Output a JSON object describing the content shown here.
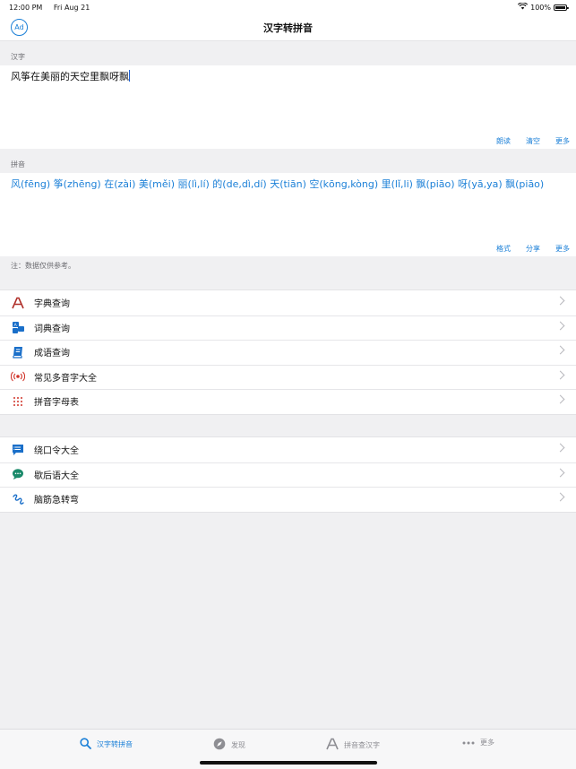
{
  "status_bar": {
    "time": "12:00 PM",
    "date": "Fri Aug 21",
    "battery": "100%"
  },
  "navbar": {
    "title": "汉字转拼音",
    "ad_label": "Ad"
  },
  "hanzi_section": {
    "label": "汉字",
    "text": "风筝在美丽的天空里飘呀飘",
    "actions": [
      "朗读",
      "清空",
      "更多"
    ]
  },
  "pinyin_section": {
    "label": "拼音",
    "text": "风(fēng) 筝(zhēng) 在(zài) 美(měi) 丽(lì,lí) 的(de,dì,dí) 天(tiān) 空(kōng,kòng) 里(lǐ,li) 飘(piāo) 呀(yā,ya) 飘(piāo)",
    "actions": [
      "格式",
      "分享",
      "更多"
    ]
  },
  "note": "注：数据仅供参考。",
  "menu_group_1": [
    {
      "label": "字典查询",
      "icon": "letter-a-icon"
    },
    {
      "label": "词典查询",
      "icon": "dictionary-blocks-icon"
    },
    {
      "label": "成语查询",
      "icon": "book-icon"
    },
    {
      "label": "常见多音字大全",
      "icon": "broadcast-icon"
    },
    {
      "label": "拼音字母表",
      "icon": "dots-grid-icon"
    }
  ],
  "menu_group_2": [
    {
      "label": "绕口令大全",
      "icon": "list-bubble-icon"
    },
    {
      "label": "歇后语大全",
      "icon": "chat-bubble-icon"
    },
    {
      "label": "脑筋急转弯",
      "icon": "squiggle-icon"
    }
  ],
  "tabs": [
    {
      "label": "汉字转拼音",
      "icon": "search-icon",
      "active": true
    },
    {
      "label": "发现",
      "icon": "compass-icon",
      "active": false
    },
    {
      "label": "拼音查汉字",
      "icon": "letter-a-icon",
      "active": false
    },
    {
      "label": "更多",
      "icon": "more-dots-icon",
      "active": false
    }
  ],
  "colors": {
    "accent": "#1a7fd7",
    "background": "#f0f0f2",
    "red_icon": "#c0392b",
    "teal_icon": "#1a8a6a"
  }
}
